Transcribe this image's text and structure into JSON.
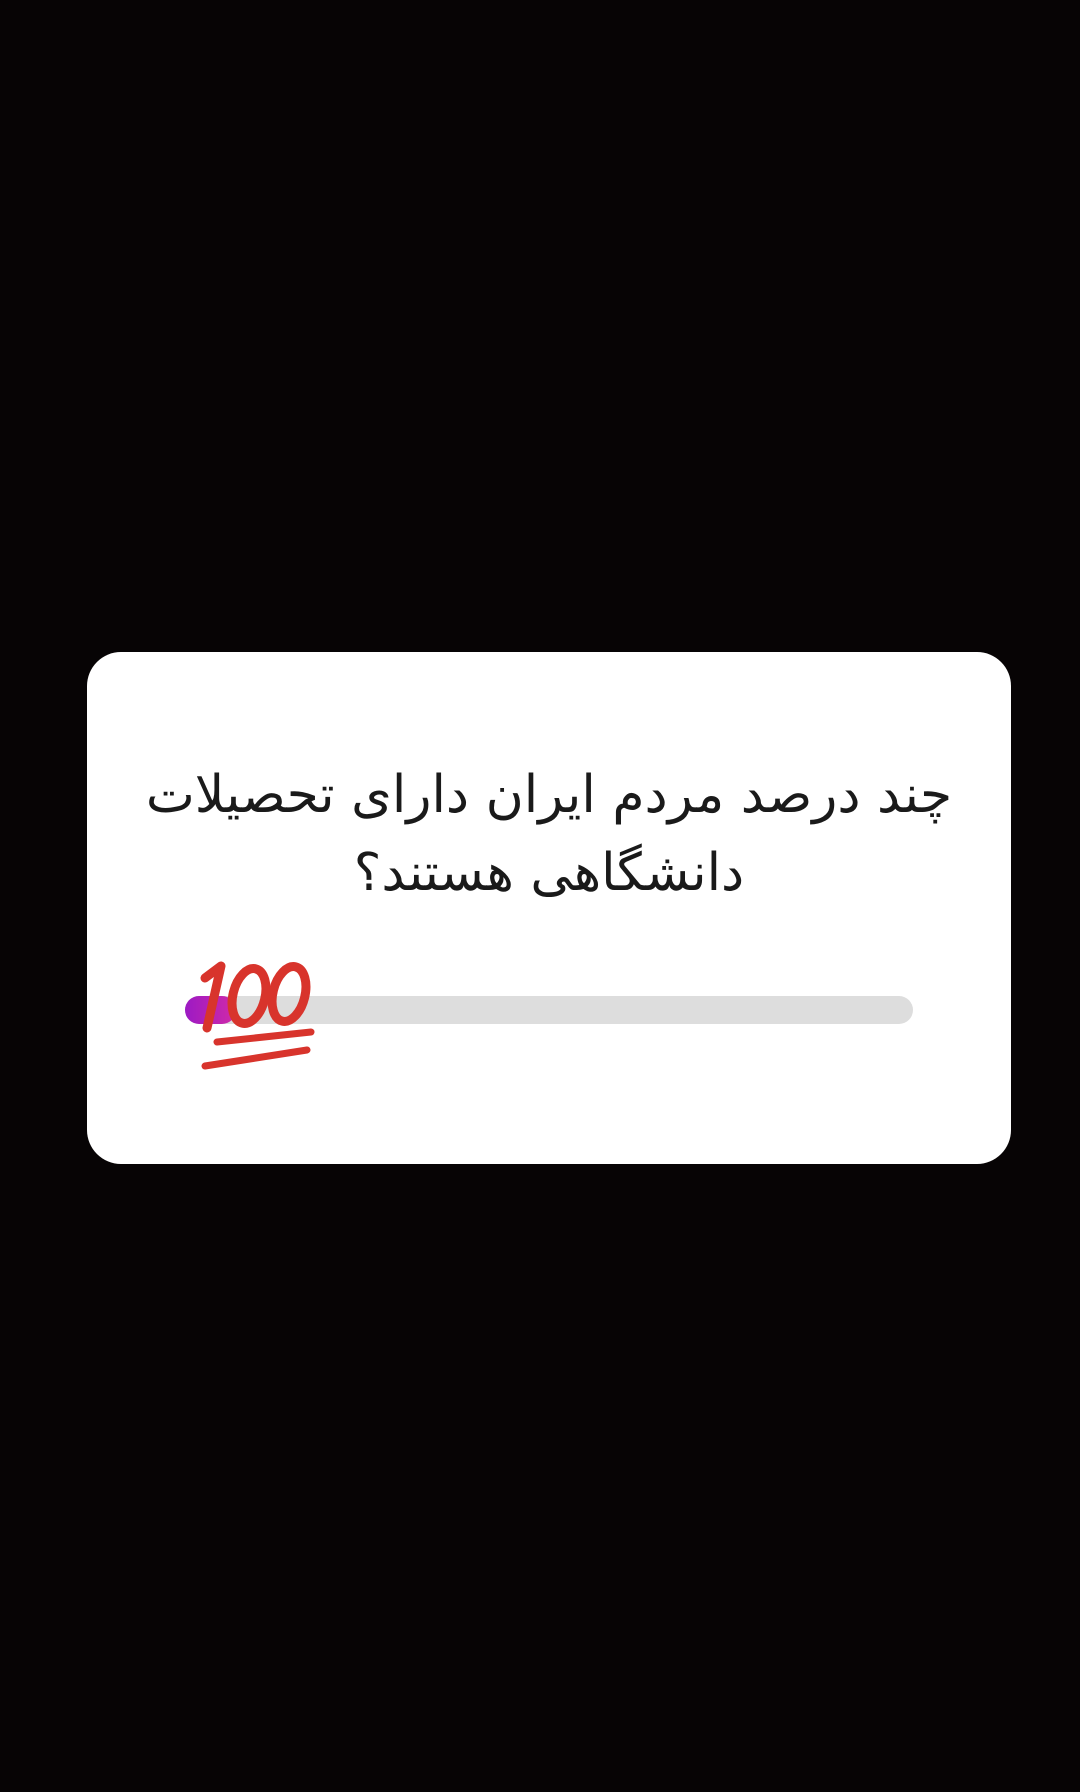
{
  "poll": {
    "question": "چند درصد مردم ایران دارای تحصیلات دانشگاهی هستند؟",
    "slider": {
      "value_fraction": 0.07,
      "fill_color": "#b41fbd",
      "track_color": "#dddddd",
      "thumb_icon": "hundred-points-emoji-icon"
    }
  },
  "colors": {
    "background": "#070405",
    "card": "#ffffff",
    "emoji_red": "#d8342c"
  }
}
